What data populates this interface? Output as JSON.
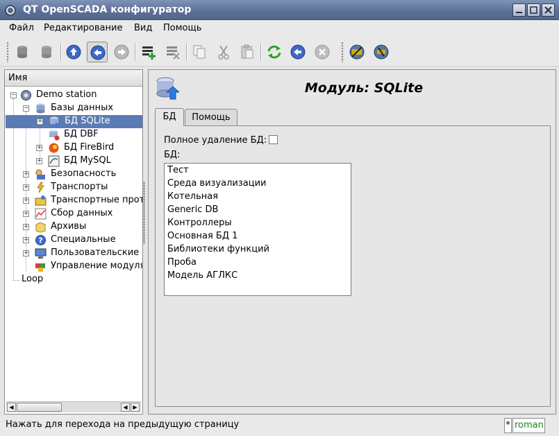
{
  "window": {
    "title": "QT OpenSCADA конфигуратор"
  },
  "menu": [
    {
      "label": "Файл"
    },
    {
      "label": "Редактирование"
    },
    {
      "label": "Вид"
    },
    {
      "label": "Помощь"
    }
  ],
  "tree": {
    "header": "Имя",
    "items": [
      {
        "label": "Demo station",
        "icon": "station-icon"
      },
      {
        "label": "Базы данных",
        "icon": "database-icon"
      },
      {
        "label": "БД SQLite",
        "icon": "sqlite-icon",
        "selected": true
      },
      {
        "label": "БД DBF",
        "icon": "dbf-icon"
      },
      {
        "label": "БД FireBird",
        "icon": "firebird-icon"
      },
      {
        "label": "БД MySQL",
        "icon": "mysql-icon"
      },
      {
        "label": "Безопасность",
        "icon": "security-icon"
      },
      {
        "label": "Транспорты",
        "icon": "transport-icon"
      },
      {
        "label": "Транспортные прот",
        "icon": "protocol-icon"
      },
      {
        "label": "Сбор данных",
        "icon": "data-acquisition-icon"
      },
      {
        "label": "Архивы",
        "icon": "archive-icon"
      },
      {
        "label": "Специальные",
        "icon": "help-icon"
      },
      {
        "label": "Пользовательские",
        "icon": "monitor-icon"
      },
      {
        "label": "Управление модуля",
        "icon": "modules-icon"
      },
      {
        "label": "Loop",
        "icon": ""
      }
    ]
  },
  "module": {
    "title": "Модуль: SQLite",
    "tabs": [
      {
        "label": "БД"
      },
      {
        "label": "Помощь"
      }
    ],
    "full_delete_label": "Полное удаление БД:",
    "full_delete_checked": false,
    "db_list_label": "БД:",
    "db_list": [
      "Тест",
      "Среда визуализации",
      "Котельная",
      "Generic DB",
      "Контроллеры",
      "Основная БД 1",
      "Библиотеки функций",
      "Проба",
      "Модель АГЛКС"
    ]
  },
  "status": {
    "message": "Нажать для перехода на предыдущую страницу",
    "modified_marker": "*",
    "user": "roman"
  },
  "colors": {
    "selection": "#5b7bb5",
    "titlebar": "#5b6f96",
    "user_text": "#1b7f1b"
  }
}
